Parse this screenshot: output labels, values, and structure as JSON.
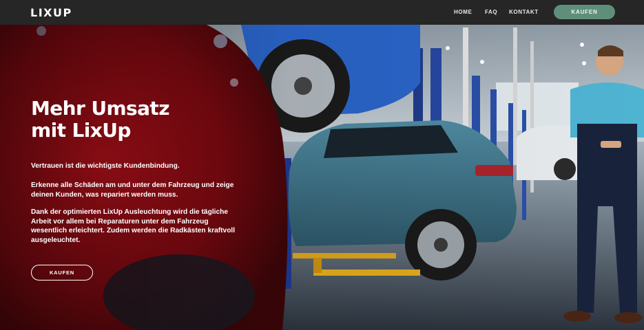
{
  "header": {
    "logo_text": "LIXUP",
    "nav": [
      {
        "label": "HOME"
      },
      {
        "label": "FAQ"
      },
      {
        "label": "KONTAKT"
      }
    ],
    "buy_label": "KAUFEN"
  },
  "hero": {
    "headline_line1": "Mehr Umsatz",
    "headline_line2": "mit LixUp",
    "paragraph1": "Vertrauen ist die wichtigste Kundenbindung.",
    "paragraph2": "Erkenne alle Schäden am und unter dem Fahrzeug und zeige deinen Kunden, was repariert werden muss.",
    "paragraph3": "Dank der optimierten LixUp Ausleuchtung wird die tägliche Arbeit vor allem bei Reparaturen unter dem Fahrzeug wesentlich erleichtert. Zudem werden die Radkästen kraftvoll ausgeleuchtet.",
    "buy_label": "KAUFEN"
  },
  "colors": {
    "header_bg": "#262626",
    "accent_button": "#5f8f7a",
    "text": "#ffffff"
  }
}
